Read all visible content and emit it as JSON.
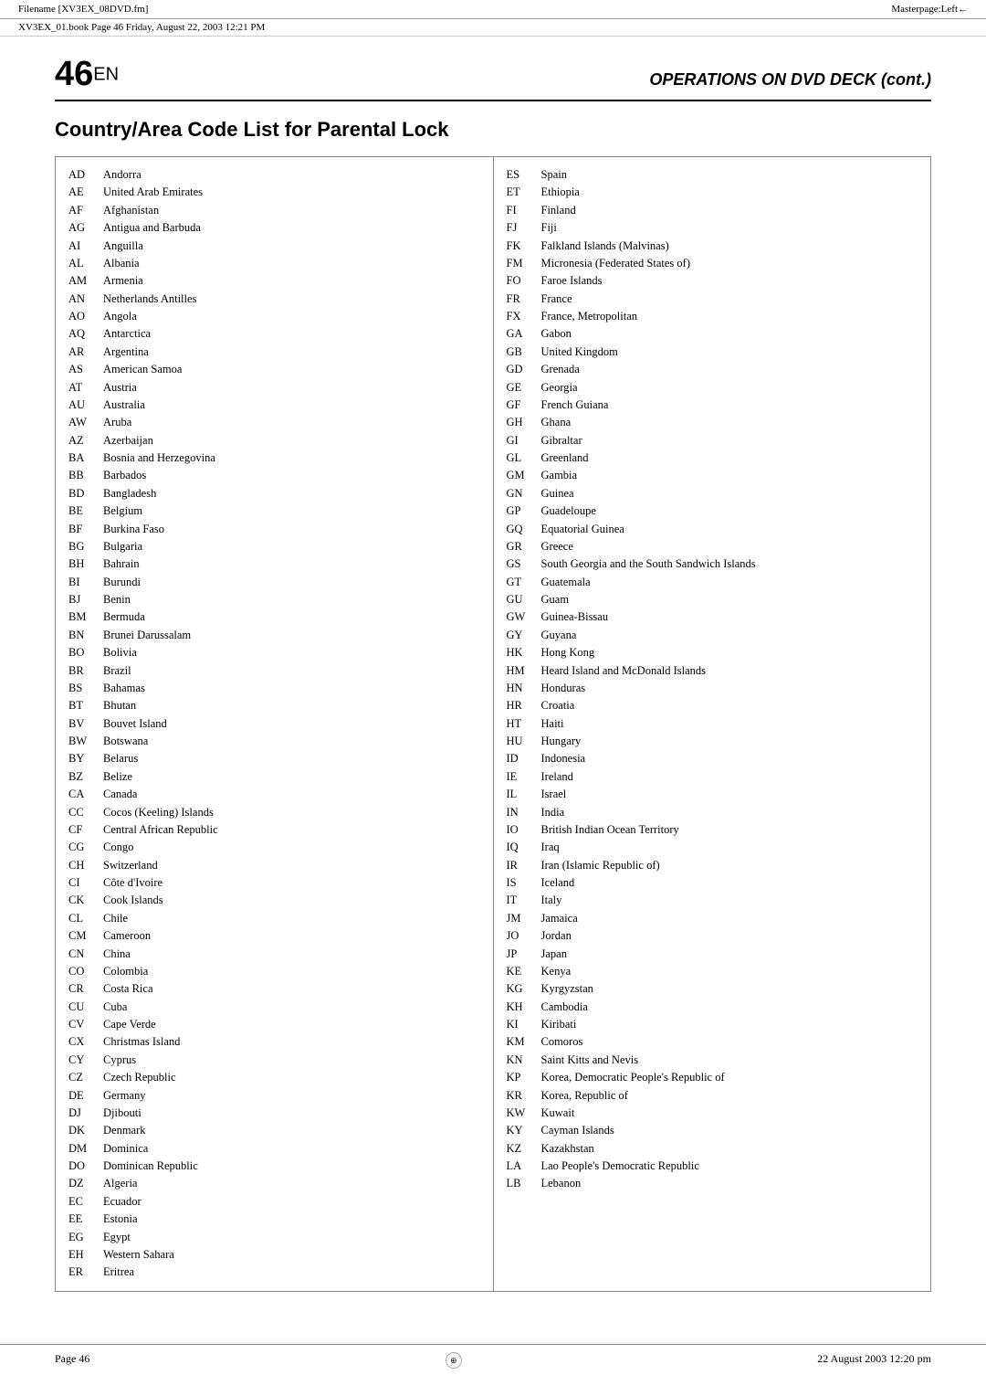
{
  "topBar": {
    "filename": "Filename [XV3EX_08DVD.fm]",
    "masterpage": "Masterpage:Left←"
  },
  "secondBar": {
    "text": "XV3EX_01.book  Page 46  Friday, August 22, 2003  12:21 PM"
  },
  "header": {
    "pageNum": "46",
    "suffix": "EN",
    "title": "OPERATIONS ON DVD DECK (cont.)"
  },
  "sectionTitle": "Country/Area Code List for Parental Lock",
  "leftColumn": [
    {
      "code": "AD",
      "name": "Andorra"
    },
    {
      "code": "AE",
      "name": "United Arab Emirates"
    },
    {
      "code": "AF",
      "name": "Afghanistan"
    },
    {
      "code": "AG",
      "name": "Antigua and Barbuda"
    },
    {
      "code": "AI",
      "name": "Anguilla"
    },
    {
      "code": "AL",
      "name": "Albania"
    },
    {
      "code": "AM",
      "name": "Armenia"
    },
    {
      "code": "AN",
      "name": "Netherlands Antilles"
    },
    {
      "code": "AO",
      "name": "Angola"
    },
    {
      "code": "AQ",
      "name": "Antarctica"
    },
    {
      "code": "AR",
      "name": "Argentina"
    },
    {
      "code": "AS",
      "name": "American Samoa"
    },
    {
      "code": "AT",
      "name": "Austria"
    },
    {
      "code": "AU",
      "name": "Australia"
    },
    {
      "code": "AW",
      "name": "Aruba"
    },
    {
      "code": "AZ",
      "name": "Azerbaijan"
    },
    {
      "code": "BA",
      "name": "Bosnia and Herzegovina"
    },
    {
      "code": "BB",
      "name": "Barbados"
    },
    {
      "code": "BD",
      "name": "Bangladesh"
    },
    {
      "code": "BE",
      "name": "Belgium"
    },
    {
      "code": "BF",
      "name": "Burkina Faso"
    },
    {
      "code": "BG",
      "name": "Bulgaria"
    },
    {
      "code": "BH",
      "name": "Bahrain"
    },
    {
      "code": "BI",
      "name": "Burundi"
    },
    {
      "code": "BJ",
      "name": "Benin"
    },
    {
      "code": "BM",
      "name": "Bermuda"
    },
    {
      "code": "BN",
      "name": "Brunei Darussalam"
    },
    {
      "code": "BO",
      "name": "Bolivia"
    },
    {
      "code": "BR",
      "name": "Brazil"
    },
    {
      "code": "BS",
      "name": "Bahamas"
    },
    {
      "code": "BT",
      "name": "Bhutan"
    },
    {
      "code": "BV",
      "name": "Bouvet Island"
    },
    {
      "code": "BW",
      "name": "Botswana"
    },
    {
      "code": "BY",
      "name": "Belarus"
    },
    {
      "code": "BZ",
      "name": "Belize"
    },
    {
      "code": "CA",
      "name": "Canada"
    },
    {
      "code": "CC",
      "name": "Cocos (Keeling) Islands"
    },
    {
      "code": "CF",
      "name": "Central African Republic"
    },
    {
      "code": "CG",
      "name": "Congo"
    },
    {
      "code": "CH",
      "name": "Switzerland"
    },
    {
      "code": "CI",
      "name": "Côte d'Ivoire"
    },
    {
      "code": "CK",
      "name": "Cook Islands"
    },
    {
      "code": "CL",
      "name": "Chile"
    },
    {
      "code": "CM",
      "name": "Cameroon"
    },
    {
      "code": "CN",
      "name": "China"
    },
    {
      "code": "CO",
      "name": "Colombia"
    },
    {
      "code": "CR",
      "name": "Costa Rica"
    },
    {
      "code": "CU",
      "name": "Cuba"
    },
    {
      "code": "CV",
      "name": "Cape Verde"
    },
    {
      "code": "CX",
      "name": "Christmas Island"
    },
    {
      "code": "CY",
      "name": "Cyprus"
    },
    {
      "code": "CZ",
      "name": "Czech Republic"
    },
    {
      "code": "DE",
      "name": "Germany"
    },
    {
      "code": "DJ",
      "name": "Djibouti"
    },
    {
      "code": "DK",
      "name": "Denmark"
    },
    {
      "code": "DM",
      "name": "Dominica"
    },
    {
      "code": "DO",
      "name": "Dominican Republic"
    },
    {
      "code": "DZ",
      "name": "Algeria"
    },
    {
      "code": "EC",
      "name": "Ecuador"
    },
    {
      "code": "EE",
      "name": "Estonia"
    },
    {
      "code": "EG",
      "name": "Egypt"
    },
    {
      "code": "EH",
      "name": "Western Sahara"
    },
    {
      "code": "ER",
      "name": "Eritrea"
    }
  ],
  "rightColumn": [
    {
      "code": "ES",
      "name": "Spain"
    },
    {
      "code": "ET",
      "name": "Ethiopia"
    },
    {
      "code": "FI",
      "name": "Finland"
    },
    {
      "code": "FJ",
      "name": "Fiji"
    },
    {
      "code": "FK",
      "name": "Falkland Islands (Malvinas)"
    },
    {
      "code": "FM",
      "name": "Micronesia (Federated States of)"
    },
    {
      "code": "FO",
      "name": "Faroe Islands"
    },
    {
      "code": "FR",
      "name": "France"
    },
    {
      "code": "FX",
      "name": "France, Metropolitan"
    },
    {
      "code": "GA",
      "name": "Gabon"
    },
    {
      "code": "GB",
      "name": "United Kingdom"
    },
    {
      "code": "GD",
      "name": "Grenada"
    },
    {
      "code": "GE",
      "name": "Georgia"
    },
    {
      "code": "GF",
      "name": "French Guiana"
    },
    {
      "code": "GH",
      "name": "Ghana"
    },
    {
      "code": "GI",
      "name": "Gibraltar"
    },
    {
      "code": "GL",
      "name": "Greenland"
    },
    {
      "code": "GM",
      "name": "Gambia"
    },
    {
      "code": "GN",
      "name": "Guinea"
    },
    {
      "code": "GP",
      "name": "Guadeloupe"
    },
    {
      "code": "GQ",
      "name": "Equatorial Guinea"
    },
    {
      "code": "GR",
      "name": "Greece"
    },
    {
      "code": "GS",
      "name": "South Georgia and the South Sandwich Islands"
    },
    {
      "code": "GT",
      "name": "Guatemala"
    },
    {
      "code": "GU",
      "name": "Guam"
    },
    {
      "code": "GW",
      "name": "Guinea-Bissau"
    },
    {
      "code": "GY",
      "name": "Guyana"
    },
    {
      "code": "HK",
      "name": "Hong Kong"
    },
    {
      "code": "HM",
      "name": "Heard Island and McDonald Islands"
    },
    {
      "code": "HN",
      "name": "Honduras"
    },
    {
      "code": "HR",
      "name": "Croatia"
    },
    {
      "code": "HT",
      "name": "Haiti"
    },
    {
      "code": "HU",
      "name": "Hungary"
    },
    {
      "code": "ID",
      "name": "Indonesia"
    },
    {
      "code": "IE",
      "name": "Ireland"
    },
    {
      "code": "IL",
      "name": "Israel"
    },
    {
      "code": "IN",
      "name": "India"
    },
    {
      "code": "IO",
      "name": "British Indian Ocean Territory"
    },
    {
      "code": "IQ",
      "name": "Iraq"
    },
    {
      "code": "IR",
      "name": "Iran (Islamic Republic of)"
    },
    {
      "code": "IS",
      "name": "Iceland"
    },
    {
      "code": "IT",
      "name": "Italy"
    },
    {
      "code": "JM",
      "name": "Jamaica"
    },
    {
      "code": "JO",
      "name": "Jordan"
    },
    {
      "code": "JP",
      "name": "Japan"
    },
    {
      "code": "KE",
      "name": "Kenya"
    },
    {
      "code": "KG",
      "name": "Kyrgyzstan"
    },
    {
      "code": "KH",
      "name": "Cambodia"
    },
    {
      "code": "KI",
      "name": "Kiribati"
    },
    {
      "code": "KM",
      "name": "Comoros"
    },
    {
      "code": "KN",
      "name": "Saint Kitts and Nevis"
    },
    {
      "code": "KP",
      "name": "Korea, Democratic People's Republic of"
    },
    {
      "code": "KR",
      "name": "Korea, Republic of"
    },
    {
      "code": "KW",
      "name": "Kuwait"
    },
    {
      "code": "KY",
      "name": "Cayman Islands"
    },
    {
      "code": "KZ",
      "name": "Kazakhstan"
    },
    {
      "code": "LA",
      "name": "Lao People's Democratic Republic"
    },
    {
      "code": "LB",
      "name": "Lebanon"
    }
  ],
  "footer": {
    "pageLabel": "Page 46",
    "timestamp": "22 August 2003  12:20 pm"
  }
}
